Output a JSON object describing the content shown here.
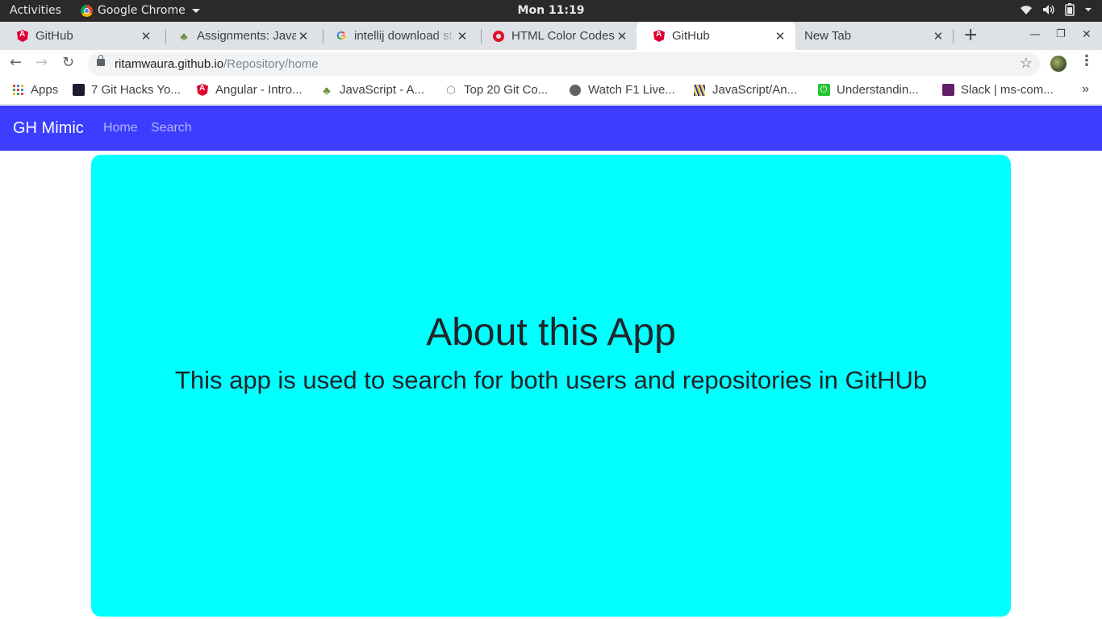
{
  "system_bar": {
    "activities": "Activities",
    "app_name": "Google Chrome",
    "clock": "Mon 11:19"
  },
  "tabs": [
    {
      "title": "GitHub",
      "icon": "angular-icon",
      "active": false
    },
    {
      "title": "Assignments: Java",
      "icon": "tree-icon",
      "active": false
    },
    {
      "title": "intellij download st",
      "icon": "google-icon",
      "active": false
    },
    {
      "title": "HTML Color Codes",
      "icon": "red-ring-icon",
      "active": false
    },
    {
      "title": "GitHub",
      "icon": "angular-icon",
      "active": true
    },
    {
      "title": "New Tab",
      "icon": "",
      "active": false
    }
  ],
  "address_bar": {
    "domain": "ritamwaura.github.io",
    "path": "/Repository/home"
  },
  "bookmarks": [
    {
      "label": "Apps",
      "icon": "apps-grid-icon"
    },
    {
      "label": "7 Git Hacks Yo...",
      "icon": "dark-square-icon"
    },
    {
      "label": "Angular - Intro...",
      "icon": "angular-icon"
    },
    {
      "label": "JavaScript - A...",
      "icon": "tree-icon"
    },
    {
      "label": "Top 20 Git Co...",
      "icon": "hexagon-icon"
    },
    {
      "label": "Watch F1 Live...",
      "icon": "globe-icon"
    },
    {
      "label": "JavaScript/An...",
      "icon": "stripes-icon"
    },
    {
      "label": "Understandin...",
      "icon": "green-power-icon"
    },
    {
      "label": "Slack | ms-com...",
      "icon": "slack-icon"
    }
  ],
  "page": {
    "navbar": {
      "brand": "GH Mimic",
      "links": [
        "Home",
        "Search"
      ],
      "color": "#3d3dff"
    },
    "card": {
      "heading": "About this App",
      "text": "This app is used to search for both users and repositories in GitHUb",
      "color": "#00ffff"
    }
  }
}
